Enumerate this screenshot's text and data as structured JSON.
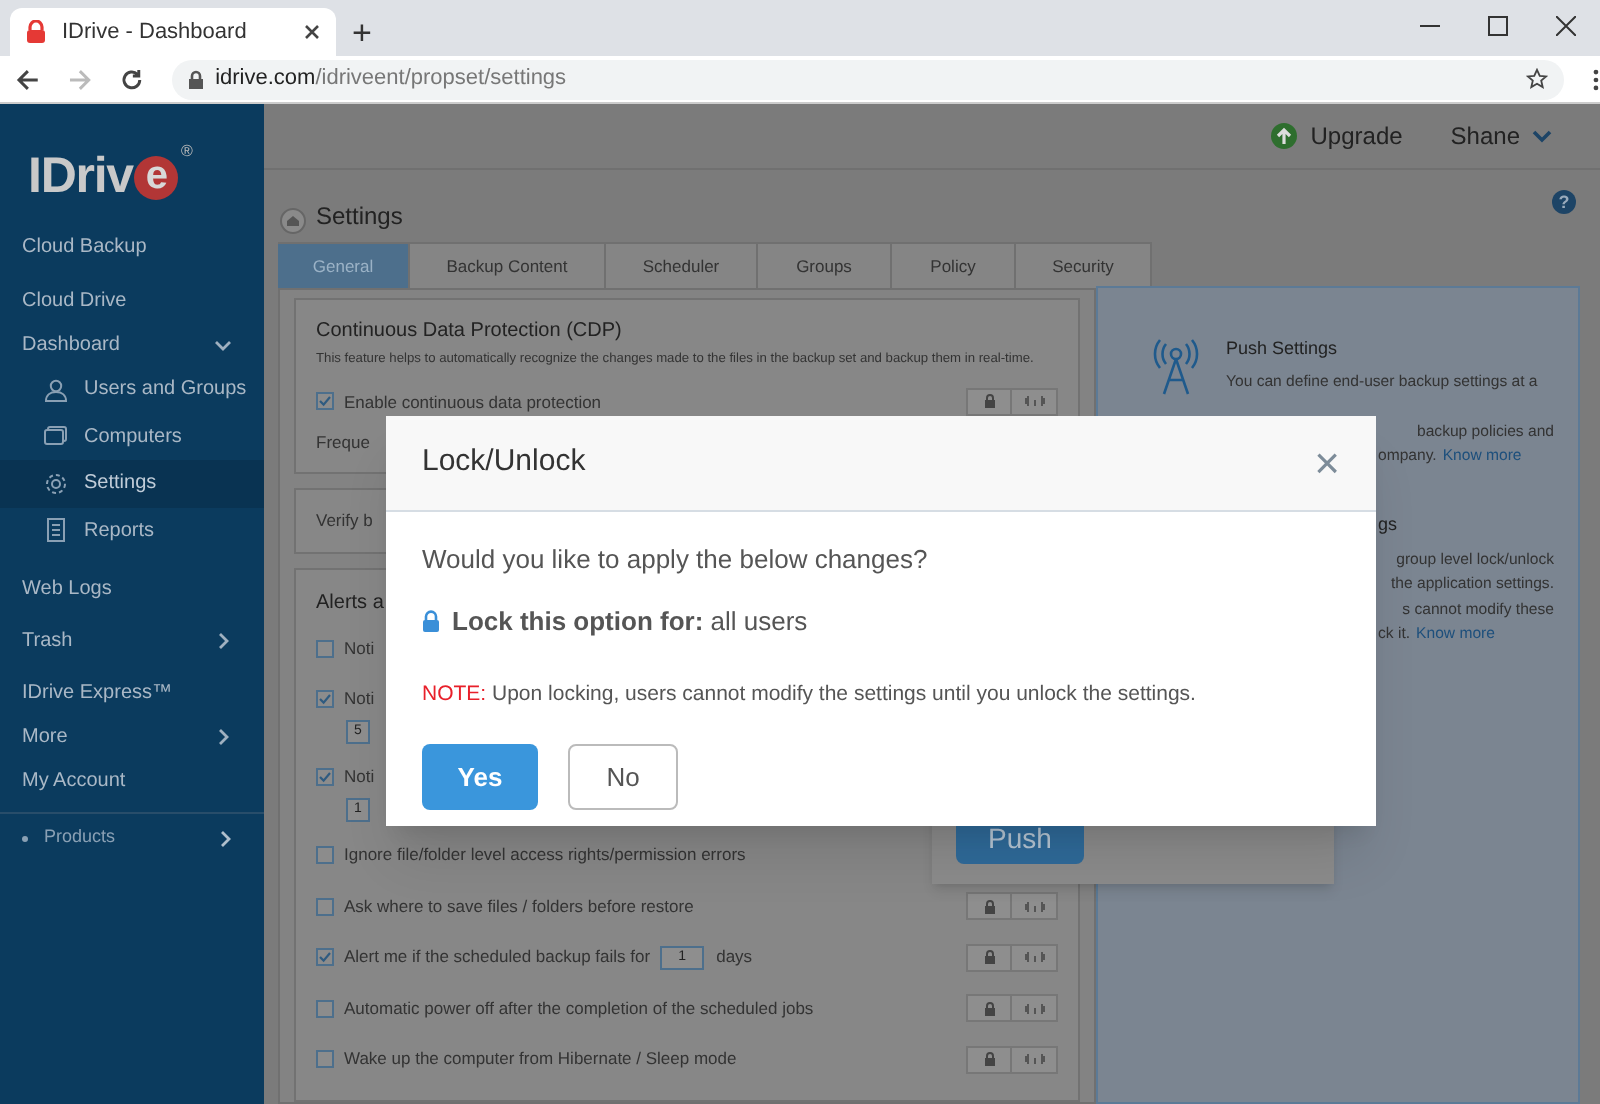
{
  "browser": {
    "tab_title": "IDrive - Dashboard",
    "new_tab": "+",
    "url_host": "idrive.com",
    "url_path": "/idriveent/propset/settings"
  },
  "header": {
    "upgrade": "Upgrade",
    "user": "Shane",
    "help": "?"
  },
  "sidebar": {
    "logo": "IDriv",
    "logo_badge": "e",
    "logo_mark": "®",
    "items": [
      {
        "label": "Cloud Backup",
        "kind": "top",
        "selected": false
      },
      {
        "label": "Cloud Drive",
        "kind": "top",
        "selected": false
      },
      {
        "label": "Dashboard",
        "kind": "group",
        "selected": false,
        "expanded": true
      },
      {
        "label": "Users and Groups",
        "kind": "sub",
        "selected": false
      },
      {
        "label": "Computers",
        "kind": "sub",
        "selected": false
      },
      {
        "label": "Settings",
        "kind": "sub",
        "selected": true
      },
      {
        "label": "Reports",
        "kind": "sub",
        "selected": false
      },
      {
        "label": "Web Logs",
        "kind": "top",
        "selected": false
      },
      {
        "label": "Trash",
        "kind": "group",
        "selected": false,
        "expanded": false
      },
      {
        "label": "IDrive Express™",
        "kind": "top",
        "selected": false
      },
      {
        "label": "More",
        "kind": "group",
        "selected": false,
        "expanded": false
      },
      {
        "label": "My Account",
        "kind": "top",
        "selected": false
      }
    ],
    "products": "Products"
  },
  "page_title": "Settings",
  "tabs": [
    {
      "label": "General",
      "selected": true
    },
    {
      "label": "Backup Content",
      "selected": false
    },
    {
      "label": "Scheduler",
      "selected": false
    },
    {
      "label": "Groups",
      "selected": false
    },
    {
      "label": "Policy",
      "selected": false
    },
    {
      "label": "Security",
      "selected": false
    }
  ],
  "cdp": {
    "title": "Continuous Data Protection (CDP)",
    "description": "This feature helps to automatically recognize the changes made to the files in the backup set and backup them in real-time.",
    "option": {
      "label": "Enable continuous data protection",
      "checked": true
    },
    "frequency": "Freque"
  },
  "verify": "Verify b",
  "alerts": {
    "title": "Alerts a",
    "rows": [
      {
        "kind": "plain",
        "label": "Noti",
        "checked": false,
        "locks": false
      },
      {
        "kind": "stacked",
        "label": "Noti",
        "checked": true,
        "select": "5",
        "locks": false
      },
      {
        "kind": "stacked",
        "label": "Noti",
        "checked": true,
        "select": "1",
        "locks": false
      },
      {
        "kind": "plain",
        "label": "Ignore file/folder level access rights/permission errors",
        "checked": false,
        "locks": false
      },
      {
        "kind": "plain",
        "label": "Ask where to save files / folders before restore",
        "checked": false,
        "locks": true
      },
      {
        "kind": "inline",
        "label": "Alert me if the scheduled backup fails for",
        "checked": true,
        "select": "1",
        "suffix": "days",
        "locks": true
      },
      {
        "kind": "plain",
        "label": "Automatic power off after the completion of the scheduled jobs",
        "checked": false,
        "locks": true
      },
      {
        "kind": "plain",
        "label": "Wake up the computer from Hibernate / Sleep mode",
        "checked": false,
        "locks": true
      }
    ]
  },
  "push_card": {
    "button": "Push"
  },
  "info": {
    "push_title": "Push Settings",
    "push_line": "You can define end-user backup settings at a",
    "push_fragments": [
      "backup policies and",
      "ompany."
    ],
    "push_link": "Know more",
    "lock_title": "gs",
    "lock_fragments": [
      "group level lock/unlock",
      "the application settings.",
      "s cannot modify these",
      "ck it."
    ],
    "lock_link": "Know more"
  },
  "modal": {
    "title": "Lock/Unlock",
    "close": "×",
    "question": "Would you like to apply the below changes?",
    "lock_label": "Lock this option for:",
    "lock_value": "all users",
    "note_label": "NOTE:",
    "note": "Upon locking, users cannot modify the settings until you unlock the settings.",
    "yes": "Yes",
    "no": "No"
  }
}
